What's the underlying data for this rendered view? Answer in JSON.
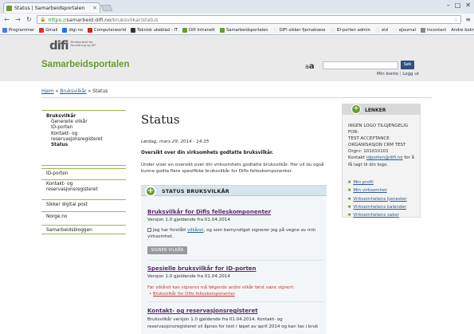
{
  "browser": {
    "tab_title": "Status | Samarbeidsportalen",
    "url_scheme": "https://",
    "url_host": "samarbeid.difi.no",
    "url_path": "/bruksvilkar/status",
    "bookmarks": [
      {
        "label": "Programmer",
        "color": "#4c7bd9"
      },
      {
        "label": "Gmail",
        "color": "#d93025"
      },
      {
        "label": "digi.no",
        "color": "#1a73e8"
      },
      {
        "label": "Computerworld",
        "color": "#c62828"
      },
      {
        "label": "Teknisk ukeblad - IT",
        "color": "#333333"
      },
      {
        "label": "Difi Intranett",
        "color": "#6a9a2f"
      },
      {
        "label": "Samarbeidsportalen",
        "color": "#6a9a2f"
      },
      {
        "label": "DIFI sikker fjernaksess",
        "color": "#eeeeee"
      },
      {
        "label": "ID-porten admin",
        "color": "#eeeeee"
      },
      {
        "label": "eid",
        "color": "#eeeeee"
      },
      {
        "label": "eJournal",
        "color": "#eeeeee"
      },
      {
        "label": "Incontact",
        "color": "#888888"
      }
    ],
    "bookmarks_other": "Andre bokmerker"
  },
  "header": {
    "logo_text": "difi",
    "logo_sub": "Direktoratet for forvaltning og IKT",
    "portal_title": "Samarbeidsportalen",
    "text_size_label": "a",
    "search_button": "Søk",
    "min_konto": "Min konto",
    "logg_ut": "Logg ut"
  },
  "breadcrumb": {
    "home": "Hjem",
    "section": "Bruksvilkår",
    "current": "Status",
    "sep": "»"
  },
  "left_nav": {
    "group1": [
      {
        "label": "Bruksvilkår",
        "bold": true,
        "sub": false
      },
      {
        "label": "Generelle vilkår",
        "bold": false,
        "sub": true
      },
      {
        "label": "ID-porten",
        "bold": false,
        "sub": true
      },
      {
        "label": "Kontakt- og",
        "bold": false,
        "sub": true
      },
      {
        "label": "reservasjonsregisteret",
        "bold": false,
        "sub": true
      },
      {
        "label": "Status",
        "bold": true,
        "sub": true
      }
    ],
    "id_porten": "ID-porten",
    "krr_line1": "Kontakt- og",
    "krr_line2": "reservasjonsregisteret",
    "sikker_post": "Sikker digital post",
    "norge_no": "Norge.no",
    "bloggen": "Samarbeidsbloggen"
  },
  "main": {
    "title": "Status",
    "date": "Lørdag, mars 29, 2014 - 14:35",
    "lead": "Oversikt over din virksomhets godtatte bruksvilkår.",
    "intro": "Under viser en oversikt over din virksomhets godtatte bruksvilkår. Her vil du også kunne godta flere spesifikke bruksvilkår for Difis felleskomponenter.",
    "status_header": "STATUS BRUKSVILKÅR",
    "t1_title": "Bruksvilkår for Difis felleskomponenter",
    "t1_version": "Versjon 1.0 gjeldende fra 01.04.2014",
    "accept_pre": "Jeg har forstått",
    "accept_link": "vilkåret",
    "accept_post": ", og som bemyndiget signerer jeg på vegne av min virksomhet.",
    "sign_button": "SIGNER VILKÅR",
    "t2_title": "Spesielle bruksvilkår for ID-porten",
    "t2_version": "Versjon 1.0 gjeldende fra 01.04.2014",
    "prereq_text": "Før vilkåret kan signeres må følgende andre vilkår først være signert:",
    "prereq_link": "Bruksvilkår for Difis felleskomponenter",
    "t3_title": "Kontakt- og reservasjonsregisteret",
    "t3_desc": "Bruksvilkår versjon 1.0 gjeldende fra 01.04.2014. Kontakt- og reservasjonsregisteret vil åpnes for test i løpet av april 2014 og kan tas i bruk"
  },
  "lenker": {
    "title": "LENKER",
    "logo_missing": "INGEN LOGO TILGJENGELIG FOR:",
    "org_name": "TEST ACCEPTANCE ORGANISASJON CRM TEST",
    "orgnr": "Orgnr: 101010101",
    "contact_pre": "Kontakt",
    "contact_email": "idporten@difi.no",
    "contact_post": "for å få lagt til din logo.",
    "links": [
      "Min profil",
      "Min virksomhet",
      "Virksomhetens tjenester",
      "Virksomhetens kalender",
      "Virksomhetens saker"
    ]
  }
}
